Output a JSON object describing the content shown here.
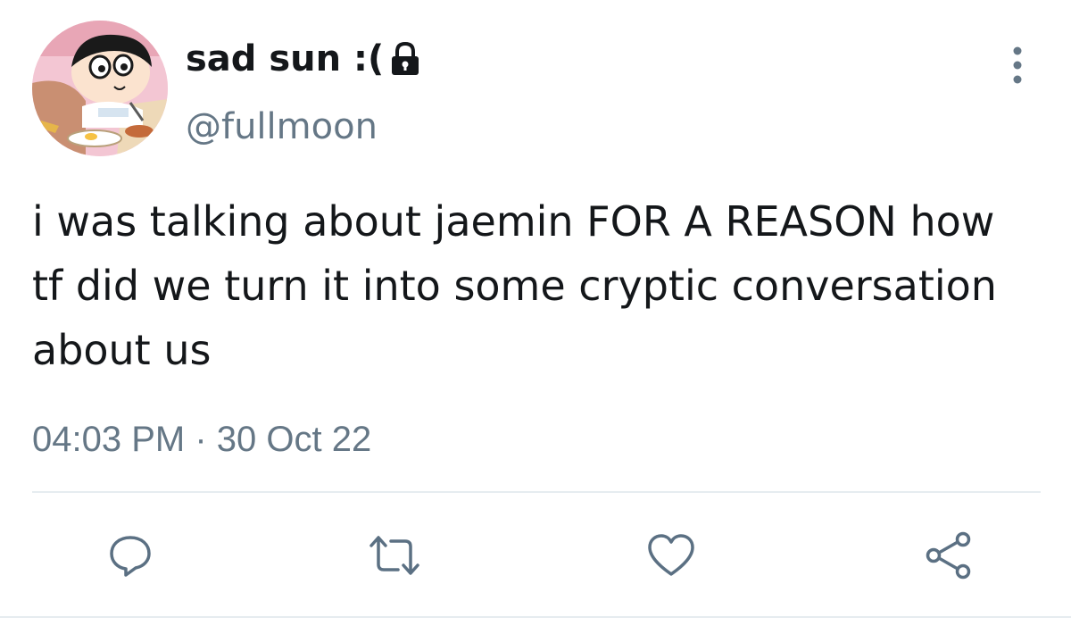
{
  "tweet": {
    "display_name": "sad sun :(",
    "handle": "@fullmoon",
    "text": "i was talking about jaemin FOR A REASON how tf did we turn it into some cryptic conversation about us",
    "timestamp": "04:03 PM · 30 Oct 22",
    "protected": true
  },
  "icons": {
    "lock": "lock-icon",
    "more": "more-vertical-icon",
    "reply": "reply-icon",
    "retweet": "retweet-icon",
    "like": "heart-icon",
    "share": "share-icon"
  },
  "colors": {
    "text_primary": "#14171a",
    "text_secondary": "#657786",
    "icon_action": "#5b7083",
    "divider": "#e6ecf0"
  }
}
